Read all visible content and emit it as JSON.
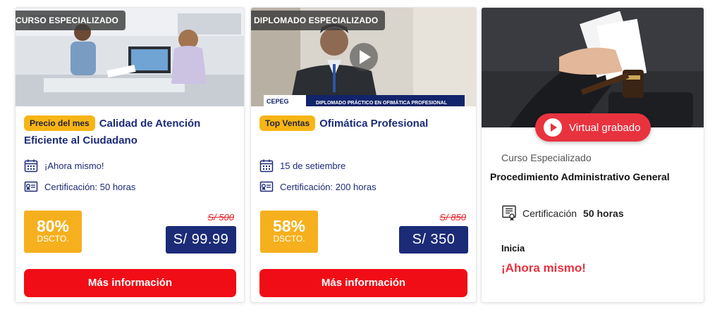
{
  "cards": [
    {
      "tag": "CURSO ESPECIALIZADO",
      "badge": "Precio del mes",
      "title": "Calidad de Atención Eficiente al Ciudadano",
      "date": "¡Ahora mismo!",
      "certification": "Certificación: 50 horas",
      "discount_pct": "80%",
      "discount_label": "DSCTO.",
      "old_price": "S/ 500",
      "price": "S/ 99.99",
      "button": "Más información"
    },
    {
      "tag": "DIPLOMADO ESPECIALIZADO",
      "badge": "Top Ventas",
      "title": "Ofimática Profesional",
      "date": "15 de setiembre",
      "certification": "Certificación: 200 horas",
      "discount_pct": "58%",
      "discount_label": "DSCTO.",
      "old_price": "S/ 850",
      "price": "S/ 350",
      "button": "Más información",
      "video_logo": "CEPEG",
      "video_caption": "DIPLOMADO PRÁCTICO EN OFIMÁTICA PROFESIONAL"
    },
    {
      "mode_button": "Virtual grabado",
      "type": "Curso Especializado",
      "title": "Procedimiento Administrativo General",
      "cert_label": "Certificación",
      "cert_hours": "50 horas",
      "starts_label": "Inicia",
      "starts_value": "¡Ahora mismo!"
    }
  ],
  "colors": {
    "navy": "#1c2b77",
    "red": "#f00d16",
    "yellow": "#f7b516",
    "virtual_red": "#e8333f"
  }
}
